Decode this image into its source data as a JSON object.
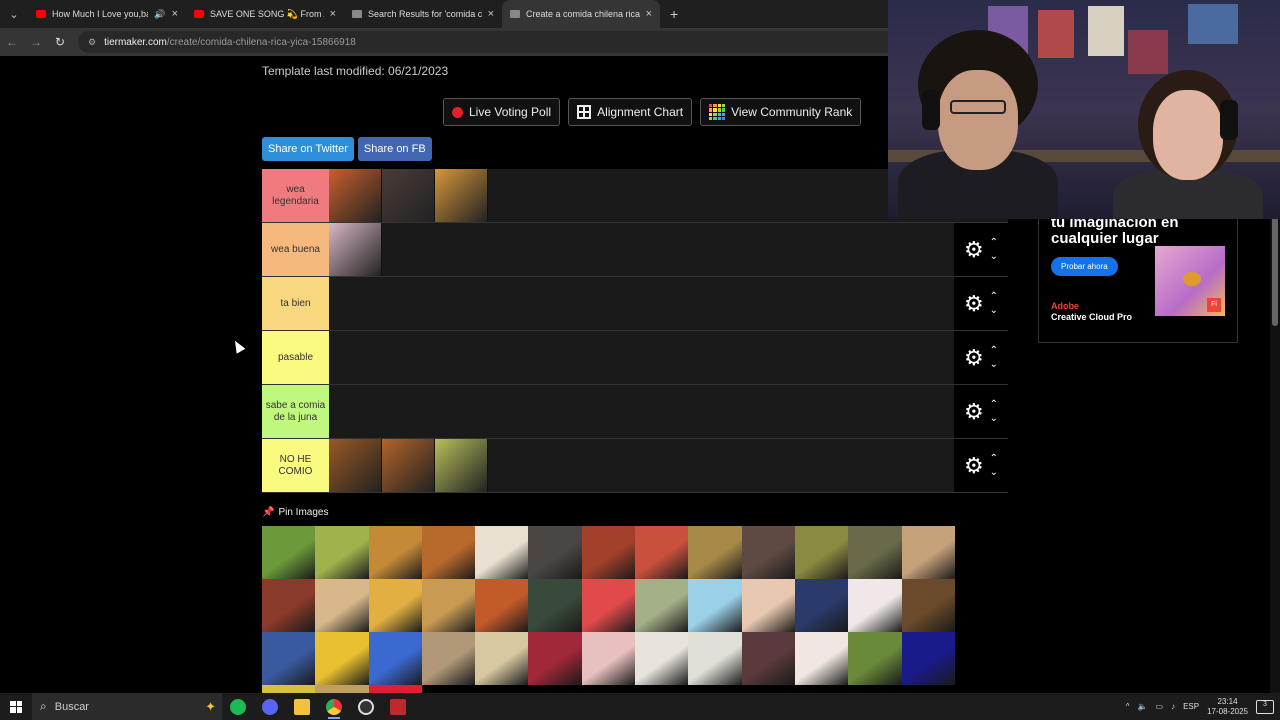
{
  "browser": {
    "tabs": [
      {
        "title": "How Much I Love you,baby",
        "favicon": "youtube-icon",
        "sound": true,
        "active": false
      },
      {
        "title": "SAVE ONE SONG 💫 From A t",
        "favicon": "youtube-icon",
        "sound": false,
        "active": false
      },
      {
        "title": "Search Results for 'comida chile",
        "favicon": "tiermaker-icon",
        "sound": false,
        "active": false
      },
      {
        "title": "Create a comida chilena rica yic",
        "favicon": "tiermaker-icon",
        "sound": false,
        "active": true
      }
    ],
    "url_domain": "tiermaker.com",
    "url_path": "/create/comida-chilena-rica-yica-15866918"
  },
  "page": {
    "modified": "Template last modified: 06/21/2023",
    "buttons": {
      "live_voting": "Live Voting Poll",
      "alignment": "Alignment Chart",
      "community_rank": "View Community Rank"
    },
    "share_twitter": "Share on Twitter",
    "share_fb": "Share on FB",
    "pin_label": "Pin Images"
  },
  "tiers": [
    {
      "label": "wea legendaria",
      "color": "#f07b7f",
      "items": [
        "#c9602c",
        "#4a3c38",
        "#d7973a"
      ]
    },
    {
      "label": "wea buena",
      "color": "#f6b97d",
      "items": [
        "#d8b8c6"
      ]
    },
    {
      "label": "ta bien",
      "color": "#f8d77f",
      "items": []
    },
    {
      "label": "pasable",
      "color": "#fafa80",
      "items": []
    },
    {
      "label": "sabe a comia de la juna",
      "color": "#bff77f",
      "items": []
    },
    {
      "label": "NO HE COMIO",
      "color": "#fafa80",
      "items": [
        "#9a5a24",
        "#b26428",
        "#b8c05a"
      ]
    }
  ],
  "pool_colors": [
    "#6c9a3a",
    "#9fb24c",
    "#c48a38",
    "#b86a2c",
    "#e8e0d0",
    "#4a4644",
    "#a2402a",
    "#c8503c",
    "#a88a48",
    "#5e4a42",
    "#8a8a42",
    "#6a6a4a",
    "#c6a27a",
    "#8a3a2a",
    "#d8b88a",
    "#e2b042",
    "#c89a52",
    "#c25a2a",
    "#3a4a3a",
    "#e04a4a",
    "#a4b088",
    "#9ad0e8",
    "#e8c8b0",
    "#2a3a6a",
    "#f0e8e8",
    "#6a4a2a",
    "#3a5aa0",
    "#e8c030",
    "#3a6ad0",
    "#b09878",
    "#d8c8a0",
    "#a02838",
    "#e8c0c0",
    "#e8e4dc",
    "#e0e0d8",
    "#5a3a3a",
    "#f0e8e0",
    "#6a8a3a",
    "#1a1a8a",
    "#d8c040",
    "#c0a060",
    "#e02030"
  ],
  "ad": {
    "headline": "tu imaginación en cualquier lugar",
    "cta": "Probar ahora",
    "brand_line1": "Adobe",
    "brand_line2": "Creative Cloud Pro",
    "badge": "Fi"
  },
  "taskbar": {
    "search_placeholder": "Buscar",
    "lang": "ESP",
    "time": "23:14",
    "date": "17-08-2025",
    "notif_count": "3"
  }
}
